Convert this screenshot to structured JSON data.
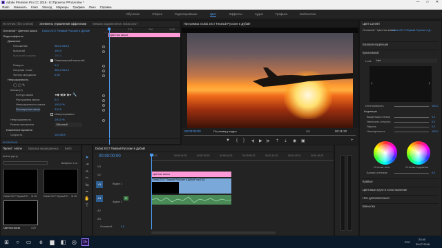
{
  "window": {
    "title": "Adobe Premiere Pro CC 2018 - E:\\Проекты PPro\\Anime *",
    "controls": [
      "—",
      "□",
      "✕"
    ]
  },
  "menu": [
    "Файл",
    "Изменить",
    "Клип",
    "Эпизод",
    "Маркеры",
    "Графика",
    "Окно",
    "Справка"
  ],
  "workspaces": {
    "items": [
      "Обучение",
      "Сборка",
      "Редактирование",
      "Цвет",
      "Эффекты",
      "Аудио",
      "Графика",
      "Библиотеки"
    ],
    "active": "Цвет"
  },
  "effect_controls": {
    "tabs": [
      "Источник: (без клипов)",
      "Элементы управления эффектами",
      "Микшер аудиоклипов: Dubai 2017"
    ],
    "header_left": "Основной * Цветная маска",
    "header_right": "Dubai 2017 Первый Русские в Дубай!",
    "ruler_ticks": [
      "370",
      "750",
      "1130"
    ],
    "clip_label": "Цветная маска",
    "sections": [
      "Видеоэффекты",
      "fx Движение",
      "fx Непрозрачность"
    ],
    "rows": [
      {
        "label": "Движение",
        "value": ""
      },
      {
        "label": "Положение",
        "value": "960,0   540,0"
      },
      {
        "label": "Масштаб",
        "value": "100,0"
      },
      {
        "label": "Масштаб ширины",
        "value": "100,0"
      },
      {
        "label": "Равномерный масштаб",
        "value": ""
      },
      {
        "label": "Поворот",
        "value": "0,0"
      },
      {
        "label": "Опорная точка",
        "value": "960,0   540,0"
      },
      {
        "label": "Фильтр мерцания",
        "value": "0,00"
      },
      {
        "label": "Непрозрачность",
        "value": ""
      },
      {
        "label": "Маска (1)",
        "value": ""
      },
      {
        "label": "Контур маски",
        "value": ""
      },
      {
        "label": "Растушевка маски",
        "value": "0,0"
      },
      {
        "label": "Непрозрачность маски",
        "value": "100,0 %"
      },
      {
        "label": "Расширение маски",
        "value": "310,0"
      },
      {
        "label": "Инвертировано",
        "value": ""
      },
      {
        "label": "Непрозрачность",
        "value": "100,0 %"
      },
      {
        "label": "Режим наложения",
        "value": "Обычный"
      },
      {
        "label": "Изменение времени",
        "value": ""
      },
      {
        "label": "Скорость",
        "value": "100,00%"
      }
    ],
    "timecode": "00:00:00:00"
  },
  "program": {
    "title": "Программа: Dubai 2017 Первый Русские в Дубай!",
    "timecode": "00:00:00:00",
    "fit": "По размеру кадра",
    "quality": "1/2",
    "duration": "00:11:20"
  },
  "lumetri": {
    "title": "Цвет Lumetri",
    "header_left": "Основной * Цветная маска",
    "header_right": "Dubai 2017 Первый Русские в Д...",
    "sections": [
      "Базовая коррекция",
      "Креативный"
    ],
    "look_label": "Look",
    "look_value": "Нет",
    "intensity_label": "Интенсивность",
    "intensity_value": "100,0",
    "adjust_label": "Коррекции",
    "sliders": [
      {
        "label": "Выцветшая пленка",
        "value": "0,0"
      },
      {
        "label": "Увеличить четкость",
        "value": "0,0"
      },
      {
        "label": "Яркость",
        "value": "0,0"
      },
      {
        "label": "Насыщенность",
        "value": "100,0"
      }
    ],
    "wheel_labels": [
      "Оттенки тени",
      "Оттенки подсветки"
    ],
    "balance_label": "Баланс оттенков",
    "balance_value": "0,0",
    "bottom_sections": [
      "Кривые",
      "Цветовые круги и сопоставление",
      "HSL дополнительно",
      "Виньетка"
    ]
  },
  "project": {
    "tabs": [
      "Проект: Anime",
      "Браузер медиаданных",
      "Библ"
    ],
    "filename": "Anime.prproj",
    "selected": "Выбрано: 1 из",
    "items": [
      {
        "name": "Dubai 2017 Первый Р...",
        "duration": "11:20"
      },
      {
        "name": "Dubai 2017 Первый Р...",
        "duration": "11:20"
      },
      {
        "name": "Цветная маска",
        "duration": "4:29"
      }
    ]
  },
  "timeline": {
    "title": "Dubai 2017 Первый Русские в Дубай!",
    "timecode": "00:00:00:00",
    "ruler": [
      "00:00",
      "00:00:14:23",
      "00:00:29:23",
      "00:00:44:22",
      "00:00:59:22",
      "00:01:14:22",
      "00:01:29:21",
      "00:01:44:21"
    ],
    "tracks": [
      "V3",
      "V2",
      "V1",
      "A1",
      "A2",
      "A3"
    ],
    "track_names": {
      "video1": "Видео 1",
      "audio1": "Аудио 1",
      "master": "Основной",
      "master_val": "0,0"
    },
    "clips": {
      "mask": "Цветная маска",
      "video": "Dubai 2017 Первый Русские в Дубай! mp4 [V]"
    }
  },
  "taskbar": {
    "time": "23:40",
    "date": "25.07.2018",
    "lang": "РУС"
  },
  "colors": {
    "accent": "#4b9cf5",
    "clip_video": "#7aa8d8",
    "clip_mask": "#ff9ad9",
    "audio": "#3f7f4a"
  }
}
